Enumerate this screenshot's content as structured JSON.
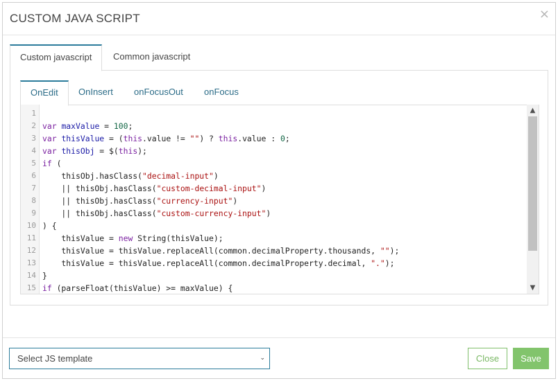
{
  "modal": {
    "title": "CUSTOM JAVA SCRIPT",
    "close_glyph": "×"
  },
  "outer_tabs": [
    {
      "label": "Custom javascript",
      "active": true
    },
    {
      "label": "Common javascript",
      "active": false
    }
  ],
  "inner_tabs": [
    {
      "label": "OnEdit",
      "active": true
    },
    {
      "label": "OnInsert",
      "active": false
    },
    {
      "label": "onFocusOut",
      "active": false
    },
    {
      "label": "onFocus",
      "active": false
    }
  ],
  "code_lines": [
    {
      "n": "1",
      "html": ""
    },
    {
      "n": "2",
      "html": "<span class=\"kw\">var</span> <span class=\"vr\">maxValue</span> = <span class=\"nm\">100</span>;"
    },
    {
      "n": "3",
      "html": "<span class=\"kw\">var</span> <span class=\"vr\">thisValue</span> = (<span class=\"kw\">this</span>.value != <span class=\"st\">\"\"</span>) ? <span class=\"kw\">this</span>.value : <span class=\"nm\">0</span>;"
    },
    {
      "n": "4",
      "html": "<span class=\"kw\">var</span> <span class=\"vr\">thisObj</span> = $(<span class=\"kw\">this</span>);"
    },
    {
      "n": "5",
      "html": "<span class=\"kw\">if</span> ("
    },
    {
      "n": "6",
      "html": "    thisObj.hasClass(<span class=\"st\">\"decimal-input\"</span>)"
    },
    {
      "n": "7",
      "html": "    || thisObj.hasClass(<span class=\"st\">\"custom-decimal-input\"</span>)"
    },
    {
      "n": "8",
      "html": "    || thisObj.hasClass(<span class=\"st\">\"currency-input\"</span>)"
    },
    {
      "n": "9",
      "html": "    || thisObj.hasClass(<span class=\"st\">\"custom-currency-input\"</span>)"
    },
    {
      "n": "10",
      "html": ") {"
    },
    {
      "n": "11",
      "html": "    thisValue = <span class=\"kw\">new</span> String(thisValue);"
    },
    {
      "n": "12",
      "html": "    thisValue = thisValue.replaceAll(common.decimalProperty.thousands, <span class=\"st\">\"\"</span>);"
    },
    {
      "n": "13",
      "html": "    thisValue = thisValue.replaceAll(common.decimalProperty.decimal, <span class=\"st\">\".\"</span>);"
    },
    {
      "n": "14",
      "html": "}"
    },
    {
      "n": "15",
      "html": "<span class=\"kw\">if</span> (parseFloat(thisValue) >= maxValue) {"
    }
  ],
  "footer": {
    "template_select": {
      "selected": "Select JS template"
    },
    "close_label": "Close",
    "save_label": "Save"
  },
  "colors": {
    "accent": "#2a7b9b",
    "success": "#82c46c"
  }
}
